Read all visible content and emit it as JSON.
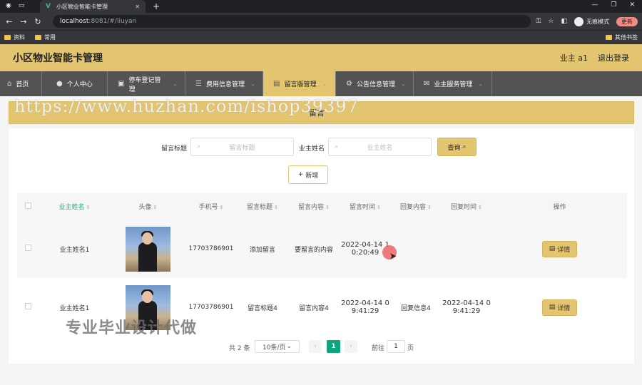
{
  "browser": {
    "tab_title": "小区物业智能卡管理",
    "url_host": "localhost",
    "url_path": ":8081/#/liuyan",
    "incognito_label": "无痕模式",
    "update_label": "更新",
    "bookmarks": [
      "资料",
      "常用"
    ],
    "other_bookmarks": "其他书签"
  },
  "header": {
    "title": "小区物业智能卡管理",
    "user_label": "业主 a1",
    "logout_label": "退出登录"
  },
  "nav": {
    "items": [
      {
        "label": "首页",
        "icon": "home-icon"
      },
      {
        "label": "个人中心",
        "icon": "user-icon"
      },
      {
        "label": "停车登记管理",
        "icon": "car-icon"
      },
      {
        "label": "费用信息管理",
        "icon": "list-icon"
      },
      {
        "label": "留言版管理",
        "icon": "document-icon"
      },
      {
        "label": "公告信息管理",
        "icon": "gear-icon"
      },
      {
        "label": "业主服务管理",
        "icon": "mail-icon"
      }
    ],
    "active_index": 4
  },
  "breadcrumb": {
    "text": "留言"
  },
  "watermarks": {
    "top": "https://www.huzhan.com/ishop39397",
    "bottom": "专业毕业设计代做"
  },
  "search": {
    "title_label": "留言标题",
    "title_placeholder": "留言标题",
    "owner_label": "业主姓名",
    "owner_placeholder": "业主姓名",
    "query_button": "查询",
    "add_button": "新增"
  },
  "table": {
    "columns": [
      "业主姓名",
      "头像",
      "手机号",
      "留言标题",
      "留言内容",
      "留言时间",
      "回复内容",
      "回复时间",
      "操作"
    ],
    "rows": [
      {
        "owner": "业主姓名1",
        "phone": "17703786901",
        "title": "添加留言",
        "content": "要留言的内容",
        "time": "2022-04-14 10:20:49",
        "reply": "",
        "reply_time": ""
      },
      {
        "owner": "业主姓名1",
        "phone": "17703786901",
        "title": "留言标题4",
        "content": "留言内容4",
        "time": "2022-04-14 09:41:29",
        "reply": "回复信息4",
        "reply_time": "2022-04-14 09:41:29"
      }
    ],
    "detail_button": "详情"
  },
  "pagination": {
    "total": "共 2 条",
    "page_size": "10条/页",
    "current_page": "1",
    "goto_label": "前往",
    "goto_value": "1",
    "page_suffix": "页"
  },
  "colors": {
    "accent": "#e4c56f",
    "nav_bg": "#535353",
    "page_active": "#0fa37f"
  }
}
